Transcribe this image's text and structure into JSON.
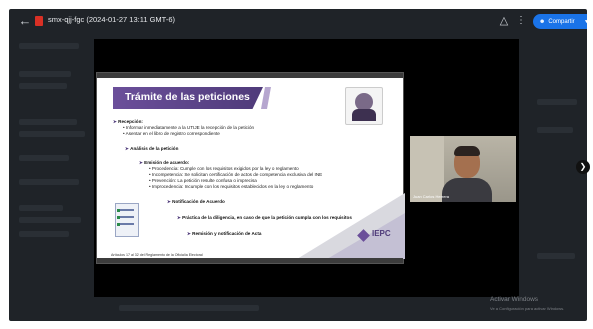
{
  "window": {
    "title": "smx-qjj-fgc (2024-01-27 13:11 GMT-6)",
    "share_label": "Compartir"
  },
  "icons": {
    "back": "back-arrow-icon",
    "file": "video-file-icon",
    "drive": "drive-add-icon",
    "more": "more-vert-icon",
    "share": "people-icon",
    "next": "chevron-right-icon"
  },
  "colors": {
    "accent": "#1a73e8",
    "slide_purple": "#4f3b7a",
    "file_red": "#d93025"
  },
  "slide": {
    "title": "Trámite de las peticiones",
    "lines": [
      "Recepción:",
      "Informar inmediatamente a la UTIJE la recepción de la petición",
      "Asentar en el libro de registro correspondiente",
      "Análisis de la petición",
      "Emisión de acuerdo:",
      "Procedencia: Cumple con los requisitos exigidos por la ley o reglamento",
      "Incompetencia: Se solicitan certificación de actos de competencia exclusiva del INE",
      "Prevención: La petición resulte confusa o imprecisa",
      "Improcedencia: Incumple con los requisitos establecidos en la ley o reglamento",
      "Notificación de Acuerdo",
      "Práctica de la diligencia, en caso de que la petición cumpla con los requisitos",
      "Remisión y notificación de Acta"
    ],
    "logo_text": "IEPC",
    "footer": "Artículos 17 al 32 del Reglamento de la Oficialía Electoral"
  },
  "participant": {
    "name": "Juan Carlos Herrera"
  },
  "watermark": {
    "title": "Activar Windows",
    "subtitle": "Ve a Configuración para activar Windows."
  }
}
